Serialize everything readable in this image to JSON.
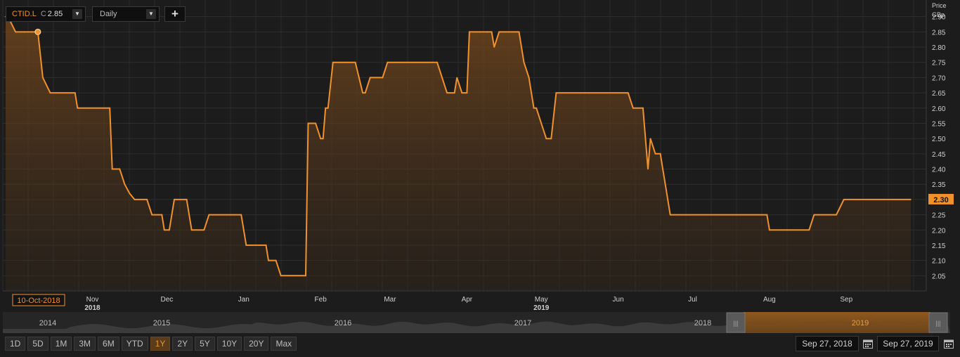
{
  "toolbar": {
    "symbol": "CTID.L",
    "close_prefix": "C",
    "close_value": "2.85",
    "interval": "Daily",
    "add_label": "+"
  },
  "axis_header": {
    "line1": "Price",
    "line2": "GBp"
  },
  "cursor_date": "10-Oct-2018",
  "current_price_label": "2.30",
  "overview_years": [
    "2014",
    "2015",
    "2016",
    "2017",
    "2018",
    "2019"
  ],
  "range_buttons": [
    "1D",
    "5D",
    "1M",
    "3M",
    "6M",
    "YTD",
    "1Y",
    "2Y",
    "5Y",
    "10Y",
    "20Y",
    "Max"
  ],
  "active_range": "1Y",
  "date_from": "Sep 27, 2018",
  "date_to": "Sep 27, 2019",
  "colors": {
    "accent": "#f0912c",
    "background": "#1c1c1c",
    "grid": "#2f2f2f"
  },
  "chart_data": {
    "type": "area",
    "symbol": "CTID.L",
    "ylabel": "Price GBp",
    "ylim": [
      2.0,
      2.95
    ],
    "y_ticks": [
      "2.05",
      "2.10",
      "2.15",
      "2.20",
      "2.25",
      "2.30",
      "2.35",
      "2.40",
      "2.45",
      "2.50",
      "2.55",
      "2.60",
      "2.65",
      "2.70",
      "2.75",
      "2.80",
      "2.85",
      "2.90"
    ],
    "x_ticks": [
      {
        "label": "Nov",
        "year": "2018",
        "x": "2018-11-01"
      },
      {
        "label": "Dec",
        "year": "",
        "x": "2018-12-01"
      },
      {
        "label": "Jan",
        "year": "",
        "x": "2019-01-01"
      },
      {
        "label": "Feb",
        "year": "",
        "x": "2019-02-01"
      },
      {
        "label": "Mar",
        "year": "",
        "x": "2019-03-01"
      },
      {
        "label": "Apr",
        "year": "",
        "x": "2019-04-01"
      },
      {
        "label": "May",
        "year": "2019",
        "x": "2019-05-01"
      },
      {
        "label": "Jun",
        "year": "",
        "x": "2019-06-01"
      },
      {
        "label": "Jul",
        "year": "",
        "x": "2019-07-01"
      },
      {
        "label": "Aug",
        "year": "",
        "x": "2019-08-01"
      },
      {
        "label": "Sep",
        "year": "",
        "x": "2019-09-01"
      }
    ],
    "grid": true,
    "highlight_point": {
      "x": "2018-10-10",
      "y": 2.85
    },
    "last_value": 2.3,
    "points": [
      [
        "2018-09-27",
        2.9
      ],
      [
        "2018-09-28",
        2.9
      ],
      [
        "2018-10-01",
        2.85
      ],
      [
        "2018-10-10",
        2.85
      ],
      [
        "2018-10-12",
        2.7
      ],
      [
        "2018-10-15",
        2.65
      ],
      [
        "2018-10-25",
        2.65
      ],
      [
        "2018-10-26",
        2.6
      ],
      [
        "2018-11-08",
        2.6
      ],
      [
        "2018-11-09",
        2.4
      ],
      [
        "2018-11-12",
        2.4
      ],
      [
        "2018-11-14",
        2.35
      ],
      [
        "2018-11-16",
        2.32
      ],
      [
        "2018-11-18",
        2.3
      ],
      [
        "2018-11-23",
        2.3
      ],
      [
        "2018-11-25",
        2.25
      ],
      [
        "2018-11-29",
        2.25
      ],
      [
        "2018-11-30",
        2.2
      ],
      [
        "2018-12-02",
        2.2
      ],
      [
        "2018-12-04",
        2.3
      ],
      [
        "2018-12-09",
        2.3
      ],
      [
        "2018-12-11",
        2.2
      ],
      [
        "2018-12-16",
        2.2
      ],
      [
        "2018-12-18",
        2.25
      ],
      [
        "2018-12-31",
        2.25
      ],
      [
        "2019-01-01",
        2.2
      ],
      [
        "2019-01-02",
        2.15
      ],
      [
        "2019-01-10",
        2.15
      ],
      [
        "2019-01-11",
        2.1
      ],
      [
        "2019-01-14",
        2.1
      ],
      [
        "2019-01-16",
        2.05
      ],
      [
        "2019-01-26",
        2.05
      ],
      [
        "2019-01-27",
        2.55
      ],
      [
        "2019-01-30",
        2.55
      ],
      [
        "2019-02-01",
        2.5
      ],
      [
        "2019-02-02",
        2.5
      ],
      [
        "2019-02-03",
        2.6
      ],
      [
        "2019-02-04",
        2.6
      ],
      [
        "2019-02-06",
        2.75
      ],
      [
        "2019-02-15",
        2.75
      ],
      [
        "2019-02-18",
        2.65
      ],
      [
        "2019-02-19",
        2.65
      ],
      [
        "2019-02-21",
        2.7
      ],
      [
        "2019-02-26",
        2.7
      ],
      [
        "2019-02-28",
        2.75
      ],
      [
        "2019-03-20",
        2.75
      ],
      [
        "2019-03-24",
        2.65
      ],
      [
        "2019-03-27",
        2.65
      ],
      [
        "2019-03-28",
        2.7
      ],
      [
        "2019-03-30",
        2.65
      ],
      [
        "2019-04-01",
        2.65
      ],
      [
        "2019-04-02",
        2.85
      ],
      [
        "2019-04-11",
        2.85
      ],
      [
        "2019-04-12",
        2.8
      ],
      [
        "2019-04-14",
        2.85
      ],
      [
        "2019-04-22",
        2.85
      ],
      [
        "2019-04-24",
        2.75
      ],
      [
        "2019-04-26",
        2.7
      ],
      [
        "2019-04-28",
        2.6
      ],
      [
        "2019-04-29",
        2.6
      ],
      [
        "2019-05-01",
        2.55
      ],
      [
        "2019-05-03",
        2.5
      ],
      [
        "2019-05-05",
        2.5
      ],
      [
        "2019-05-07",
        2.65
      ],
      [
        "2019-06-05",
        2.65
      ],
      [
        "2019-06-07",
        2.6
      ],
      [
        "2019-06-11",
        2.6
      ],
      [
        "2019-06-13",
        2.4
      ],
      [
        "2019-06-14",
        2.5
      ],
      [
        "2019-06-16",
        2.45
      ],
      [
        "2019-06-18",
        2.45
      ],
      [
        "2019-06-19",
        2.4
      ],
      [
        "2019-06-22",
        2.25
      ],
      [
        "2019-07-31",
        2.25
      ],
      [
        "2019-08-01",
        2.2
      ],
      [
        "2019-08-17",
        2.2
      ],
      [
        "2019-08-19",
        2.25
      ],
      [
        "2019-08-28",
        2.25
      ],
      [
        "2019-08-31",
        2.3
      ],
      [
        "2019-09-27",
        2.3
      ]
    ]
  }
}
